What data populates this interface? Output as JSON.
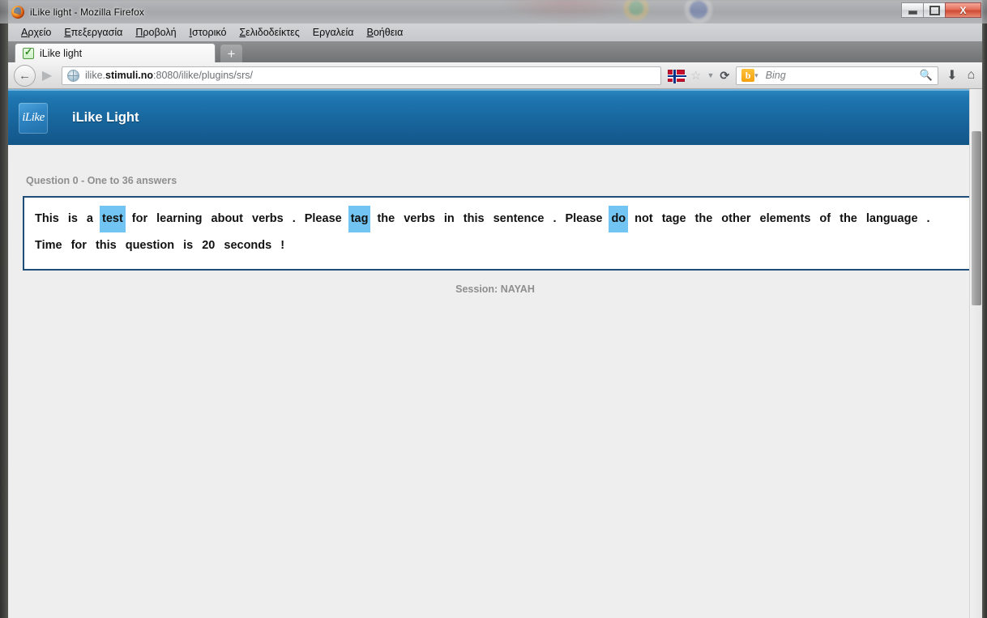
{
  "window": {
    "title": "iLike light - Mozilla Firefox",
    "minimize_label": "–",
    "maximize_label": "□",
    "close_label": "X"
  },
  "menubar": {
    "items": [
      {
        "accesskey": "Α",
        "rest": "ρχείο"
      },
      {
        "accesskey": "Ε",
        "rest": "πεξεργασία"
      },
      {
        "accesskey": "Π",
        "rest": "ροβολή"
      },
      {
        "accesskey": "Ι",
        "rest": "στορικό"
      },
      {
        "accesskey": "Σ",
        "rest": "ελιδοδείκτες"
      },
      {
        "accesskey": "",
        "rest": "Εργαλεία"
      },
      {
        "accesskey": "Β",
        "rest": "οήθεια"
      }
    ]
  },
  "tabs": {
    "active_tab_title": "iLike light",
    "new_tab_label": "+"
  },
  "navbar": {
    "back_label": "←",
    "forward_label": "▶",
    "url_prefix": "ilike.",
    "url_host": "stimuli.no",
    "url_suffix": ":8080/ilike/plugins/srs/",
    "flag_name": "norway-flag",
    "bookmark_star": "☆",
    "caret": "▼",
    "reload": "⟳",
    "search_engine": "b",
    "search_placeholder": "Bing",
    "magnifier": "⌕",
    "download": "⬇",
    "home": "⌂"
  },
  "app": {
    "logo_text": "iLike",
    "title": "iLike Light",
    "header_color": "#1e76b0"
  },
  "page": {
    "question_label": "Question 0 - One to 36 answers",
    "session_label": "Session: NAYAH",
    "highlight_color": "#72c5f2",
    "box_border_color": "#1f4e79",
    "lines": [
      [
        {
          "t": "This",
          "hl": false
        },
        {
          "t": "is",
          "hl": false
        },
        {
          "t": "a",
          "hl": false
        },
        {
          "t": "test",
          "hl": true
        },
        {
          "t": "for",
          "hl": false
        },
        {
          "t": "learning",
          "hl": false
        },
        {
          "t": "about",
          "hl": false
        },
        {
          "t": "verbs",
          "hl": false
        },
        {
          "t": ".",
          "hl": false
        },
        {
          "t": "Please",
          "hl": false
        },
        {
          "t": "tag",
          "hl": true
        },
        {
          "t": "the",
          "hl": false
        },
        {
          "t": "verbs",
          "hl": false
        },
        {
          "t": "in",
          "hl": false
        },
        {
          "t": "this",
          "hl": false
        },
        {
          "t": "sentence",
          "hl": false
        },
        {
          "t": ".",
          "hl": false
        },
        {
          "t": "Please",
          "hl": false
        },
        {
          "t": "do",
          "hl": true
        },
        {
          "t": "not",
          "hl": false
        },
        {
          "t": "tage",
          "hl": false
        },
        {
          "t": "the",
          "hl": false
        },
        {
          "t": "other",
          "hl": false
        },
        {
          "t": "elements",
          "hl": false
        },
        {
          "t": "of",
          "hl": false
        },
        {
          "t": "the",
          "hl": false
        },
        {
          "t": "language",
          "hl": false
        },
        {
          "t": ".",
          "hl": false
        },
        {
          "t": "Time",
          "hl": false
        },
        {
          "t": "for",
          "hl": false
        },
        {
          "t": "this",
          "hl": false
        },
        {
          "t": "question",
          "hl": false
        },
        {
          "t": "is",
          "hl": false
        },
        {
          "t": "20",
          "hl": false
        },
        {
          "t": "seconds",
          "hl": false
        },
        {
          "t": "!",
          "hl": false
        }
      ]
    ]
  }
}
